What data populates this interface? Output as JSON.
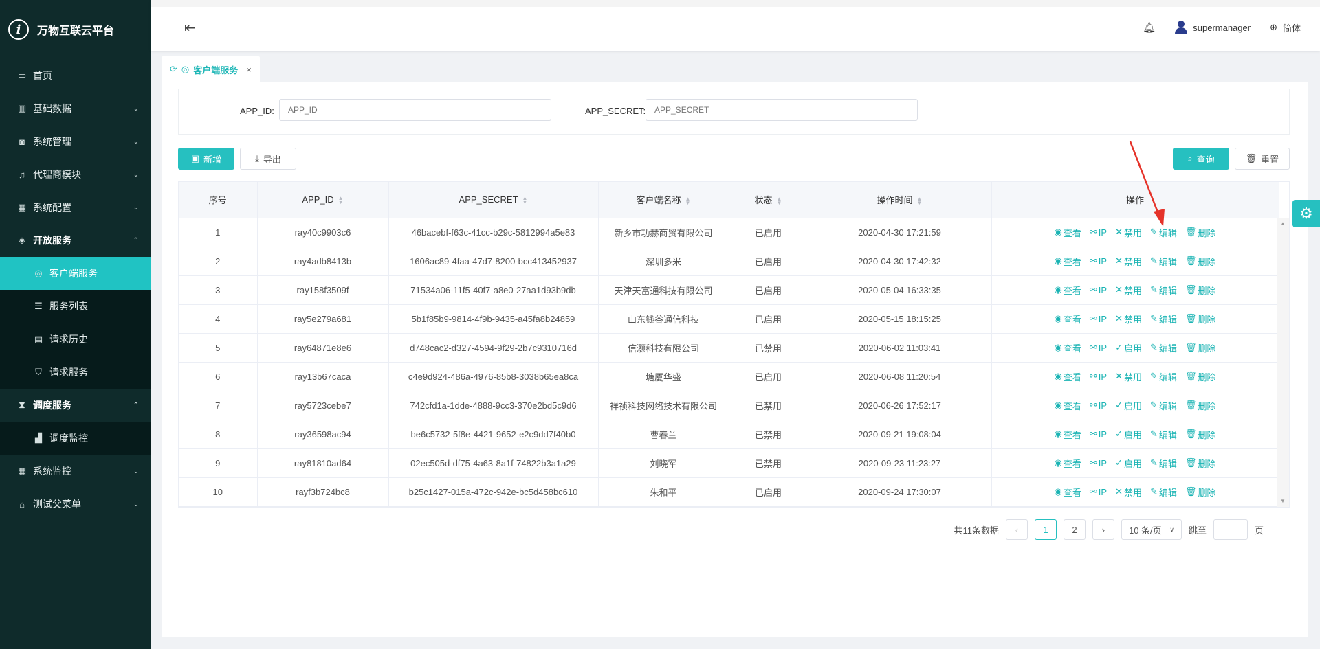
{
  "app": {
    "title": "万物互联云平台",
    "logo_letter": "i"
  },
  "sidebar": {
    "items": [
      {
        "label": "首页",
        "icon": "calendar-icon",
        "glyph": "▭",
        "chevron": ""
      },
      {
        "label": "基础数据",
        "icon": "barcode-icon",
        "glyph": "▥",
        "chevron": "⌄"
      },
      {
        "label": "系统管理",
        "icon": "camera-icon",
        "glyph": "◙",
        "chevron": "⌄"
      },
      {
        "label": "代理商模块",
        "icon": "bell-icon",
        "glyph": "♫",
        "chevron": "⌄"
      },
      {
        "label": "系统配置",
        "icon": "grid-icon",
        "glyph": "▦",
        "chevron": "⌄"
      },
      {
        "label": "开放服务",
        "icon": "tag-icon",
        "glyph": "◈",
        "chevron": "⌃",
        "open": true,
        "children": [
          {
            "label": "客户端服务",
            "icon": "target-icon",
            "glyph": "◎",
            "active": true
          },
          {
            "label": "服务列表",
            "icon": "list-icon",
            "glyph": "☰"
          },
          {
            "label": "请求历史",
            "icon": "calendar-icon",
            "glyph": "▤"
          },
          {
            "label": "请求服务",
            "icon": "shield-icon",
            "glyph": "⛉"
          }
        ]
      },
      {
        "label": "调度服务",
        "icon": "hourglass-icon",
        "glyph": "⧗",
        "chevron": "⌃",
        "open": true,
        "children": [
          {
            "label": "调度监控",
            "icon": "bar-chart-icon",
            "glyph": "▟"
          }
        ]
      },
      {
        "label": "系统监控",
        "icon": "grid-icon",
        "glyph": "▦",
        "chevron": "⌄"
      },
      {
        "label": "测试父菜单",
        "icon": "bank-icon",
        "glyph": "⌂",
        "chevron": "⌄"
      }
    ]
  },
  "header": {
    "username": "supermanager",
    "language": "简体"
  },
  "tabs": [
    {
      "label": "客户端服务",
      "close": "×"
    }
  ],
  "filter": {
    "app_id_label": "APP_ID:",
    "app_id_placeholder": "APP_ID",
    "app_secret_label": "APP_SECRET:",
    "app_secret_placeholder": "APP_SECRET"
  },
  "toolbar": {
    "add_label": "新增",
    "export_label": "导出",
    "query_label": "查询",
    "reset_label": "重置"
  },
  "table": {
    "columns": [
      "序号",
      "APP_ID",
      "APP_SECRET",
      "客户端名称",
      "状态",
      "操作时间",
      "操作"
    ],
    "op_labels": {
      "view": "查看",
      "ip": "IP",
      "disable": "禁用",
      "enable": "启用",
      "edit": "编辑",
      "delete": "删除"
    },
    "rows": [
      {
        "no": "1",
        "app_id": "ray40c9903c6",
        "secret": "46bacebf-f63c-41cc-b29c-5812994a5e83",
        "name": "新乡市功赫商贸有限公司",
        "status": "已启用",
        "time": "2020-04-30 17:21:59"
      },
      {
        "no": "2",
        "app_id": "ray4adb8413b",
        "secret": "1606ac89-4faa-47d7-8200-bcc413452937",
        "name": "深圳多米",
        "status": "已启用",
        "time": "2020-04-30 17:42:32"
      },
      {
        "no": "3",
        "app_id": "ray158f3509f",
        "secret": "71534a06-11f5-40f7-a8e0-27aa1d93b9db",
        "name": "天津天富通科技有限公司",
        "status": "已启用",
        "time": "2020-05-04 16:33:35"
      },
      {
        "no": "4",
        "app_id": "ray5e279a681",
        "secret": "5b1f85b9-9814-4f9b-9435-a45fa8b24859",
        "name": "山东钱谷通信科技",
        "status": "已启用",
        "time": "2020-05-15 18:15:25"
      },
      {
        "no": "5",
        "app_id": "ray64871e8e6",
        "secret": "d748cac2-d327-4594-9f29-2b7c9310716d",
        "name": "信灏科技有限公司",
        "status": "已禁用",
        "time": "2020-06-02 11:03:41"
      },
      {
        "no": "6",
        "app_id": "ray13b67caca",
        "secret": "c4e9d924-486a-4976-85b8-3038b65ea8ca",
        "name": "塘厦华盛",
        "status": "已启用",
        "time": "2020-06-08 11:20:54"
      },
      {
        "no": "7",
        "app_id": "ray5723cebe7",
        "secret": "742cfd1a-1dde-4888-9cc3-370e2bd5c9d6",
        "name": "祥祯科技网络技术有限公司",
        "status": "已禁用",
        "time": "2020-06-26 17:52:17"
      },
      {
        "no": "8",
        "app_id": "ray36598ac94",
        "secret": "be6c5732-5f8e-4421-9652-e2c9dd7f40b0",
        "name": "曹春兰",
        "status": "已禁用",
        "time": "2020-09-21 19:08:04"
      },
      {
        "no": "9",
        "app_id": "ray81810ad64",
        "secret": "02ec505d-df75-4a63-8a1f-74822b3a1a29",
        "name": "刘晓军",
        "status": "已禁用",
        "time": "2020-09-23 11:23:27"
      },
      {
        "no": "10",
        "app_id": "rayf3b724bc8",
        "secret": "b25c1427-015a-472c-942e-bc5d458bc610",
        "name": "朱和平",
        "status": "已启用",
        "time": "2020-09-24 17:30:07"
      }
    ]
  },
  "pagination": {
    "total": "共11条数据",
    "pages": [
      "1",
      "2"
    ],
    "current": "1",
    "page_size": "10 条/页",
    "jump_label": "跳至",
    "page_unit": "页"
  },
  "colors": {
    "accent": "#26c0c0",
    "sidebar_bg": "#0f2b2b",
    "annotation": "#e5332a"
  }
}
